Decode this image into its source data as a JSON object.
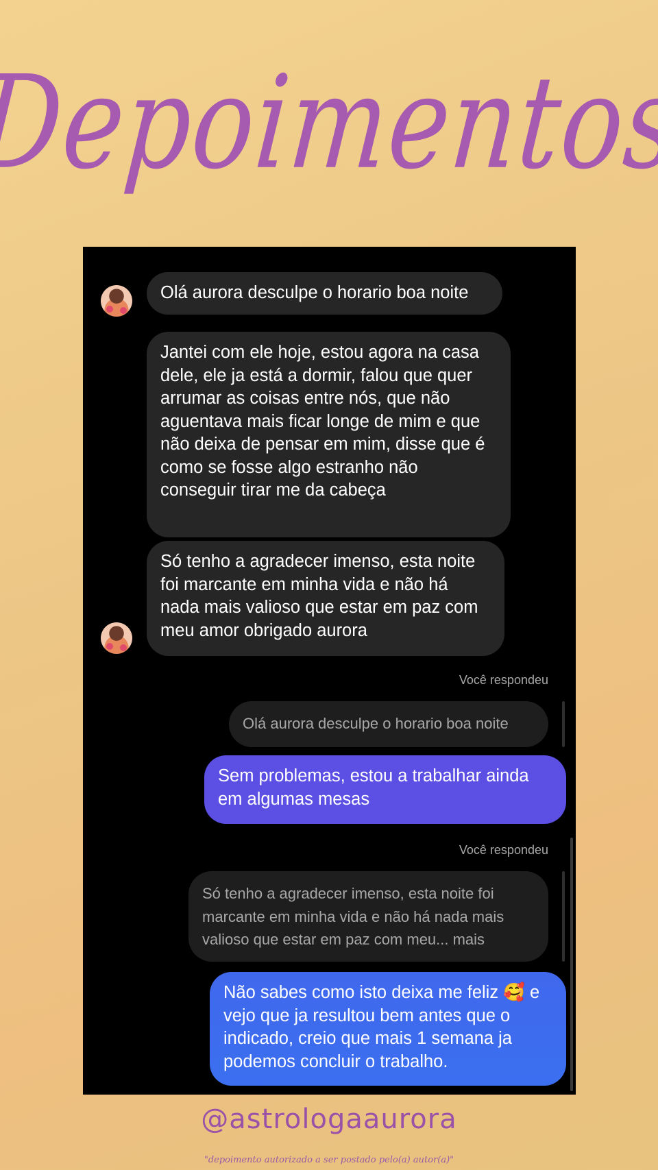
{
  "header": {
    "title": "Depoimentos"
  },
  "conversation": {
    "messages": [
      {
        "type": "incoming",
        "text": "Olá aurora desculpe o horario boa noite"
      },
      {
        "type": "incoming",
        "text": "Jantei com ele hoje, estou agora na casa dele, ele ja está a dormir, falou que quer arrumar as coisas entre nós, que não aguentava mais ficar longe de mim e que não deixa de pensar em mim, disse que é como se fosse algo estranho não conseguir tirar me da cabeça"
      },
      {
        "type": "incoming",
        "text": "Só tenho a agradecer imenso, esta noite foi marcante em minha vida e não há nada mais valioso que estar em paz com meu amor obrigado aurora"
      }
    ],
    "replies": [
      {
        "label": "Você respondeu",
        "quoted": "Olá aurora desculpe o horario boa noite",
        "text": "Sem problemas, estou a trabalhar ainda em algumas mesas"
      },
      {
        "label": "Você respondeu",
        "quoted": "Só tenho a agradecer imenso, esta noite foi marcante em minha vida e não há nada mais valioso que estar em paz com meu... mais",
        "text": "Não sabes como isto deixa me feliz 🥰 e vejo que ja resultou bem antes que o indicado, creio que mais 1 semana ja podemos concluir o trabalho."
      }
    ]
  },
  "footer": {
    "handle": "@astrologaaurora",
    "note": "\"depoimento autorizado a ser postado pelo(a) autor(a)\""
  },
  "colors": {
    "background": "#efc886",
    "title": "#a65bb0",
    "chat_bg": "#000000",
    "incoming_bubble": "#262626",
    "outgoing_bubble_1": "#5b4fe4",
    "outgoing_bubble_2": "#3b6ff0"
  }
}
